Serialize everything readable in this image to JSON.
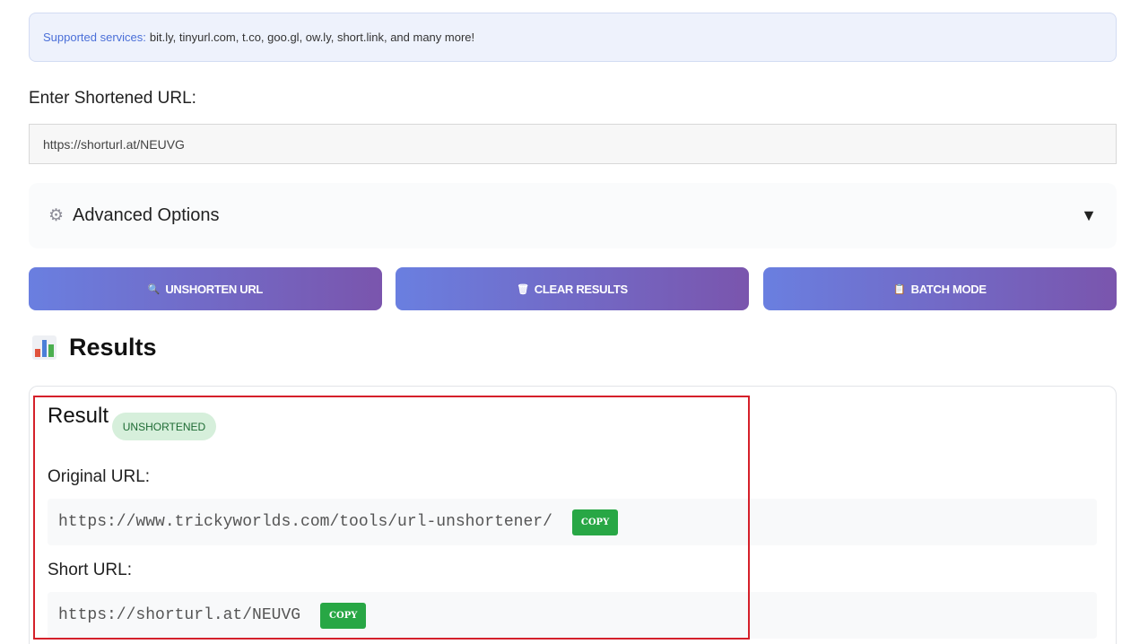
{
  "supported": {
    "label": "Supported services:",
    "text": "bit.ly, tinyurl.com, t.co, goo.gl, ow.ly, short.link, and many more!"
  },
  "form": {
    "label": "Enter Shortened URL:",
    "value": "https://shorturl.at/NEUVG"
  },
  "advanced": {
    "icon": "gear-icon",
    "title": "Advanced Options",
    "arrow": "▼"
  },
  "buttons": {
    "unshorten": {
      "icon": "magnifier-icon",
      "glyph": "🔍",
      "label": "UNSHORTEN URL"
    },
    "clear": {
      "icon": "trash-icon",
      "glyph": "🗑",
      "label": "CLEAR RESULTS"
    },
    "batch": {
      "icon": "clipboard-icon",
      "glyph": "📋",
      "label": "BATCH MODE"
    }
  },
  "results": {
    "icon": "bar-chart-icon",
    "title": "Results",
    "card": {
      "title": "Result",
      "badge": "UNSHORTENED",
      "original_label": "Original URL:",
      "original_url": "https://www.trickyworlds.com/tools/url-unshortener/",
      "short_label": "Short URL:",
      "short_url": "https://shorturl.at/NEUVG",
      "copy_label": "COPY"
    }
  },
  "colors": {
    "button_gradient_start": "#6a7fe0",
    "button_gradient_end": "#7a55ad",
    "copy_green": "#28a745",
    "badge_bg": "#d6efdb",
    "highlight_red": "#d5202a"
  }
}
